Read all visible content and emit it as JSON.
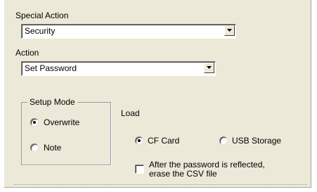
{
  "special_action": {
    "label": "Special Action",
    "selected": "Security"
  },
  "action": {
    "label": "Action",
    "selected": "Set Password"
  },
  "setup_mode": {
    "legend": "Setup Mode",
    "options": [
      {
        "label": "Overwrite",
        "checked": true
      },
      {
        "label": "Note",
        "checked": false
      }
    ]
  },
  "load": {
    "label": "Load",
    "options": [
      {
        "label": "CF Card",
        "checked": true
      },
      {
        "label": "USB Storage",
        "checked": false
      }
    ]
  },
  "erase_csv": {
    "line1": "After the password is reflected,",
    "line2": "erase the CSV file",
    "checked": false
  }
}
